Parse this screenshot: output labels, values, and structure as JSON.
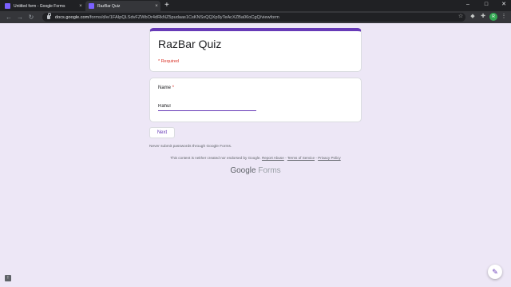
{
  "browser": {
    "tabs": [
      {
        "title": "Untitled form - Google Forms",
        "active": false,
        "close": "×"
      },
      {
        "title": "RazBar Quiz",
        "active": true,
        "close": "×"
      }
    ],
    "new_tab": "+",
    "window_controls": {
      "minimize": "–",
      "maximize": "□",
      "close": "✕"
    },
    "nav": {
      "back": "←",
      "forward": "→",
      "reload": "↻"
    },
    "url_host": "docs.google.com",
    "url_path": "/forms/d/e/1FAIpQLSdvFZWbOr4dRkNZ5pudaas1CsKNSxQQXp9yTeAcXZBa06oCgQ/viewform",
    "toolbar_icons": [
      "star-icon",
      "extensions-icon",
      "puzzle-icon",
      "menu-icon"
    ],
    "profile_initial": "R"
  },
  "form": {
    "title": "RazBar Quiz",
    "required_note": "* Required",
    "question_label": "Name",
    "question_required_mark": "*",
    "answer_value": "Rahul",
    "next_button": "Next",
    "password_warning": "Never submit passwords through Google Forms.",
    "disclaimer_prefix": "This content is neither created nor endorsed by Google.",
    "report_abuse": "Report Abuse",
    "separator": "-",
    "terms": "Terms of Service",
    "privacy": "Privacy Policy",
    "brand_google": "Google",
    "brand_forms": "Forms"
  },
  "colors": {
    "theme": "#673ab7",
    "background": "#ede7f6",
    "required": "#d93025"
  }
}
